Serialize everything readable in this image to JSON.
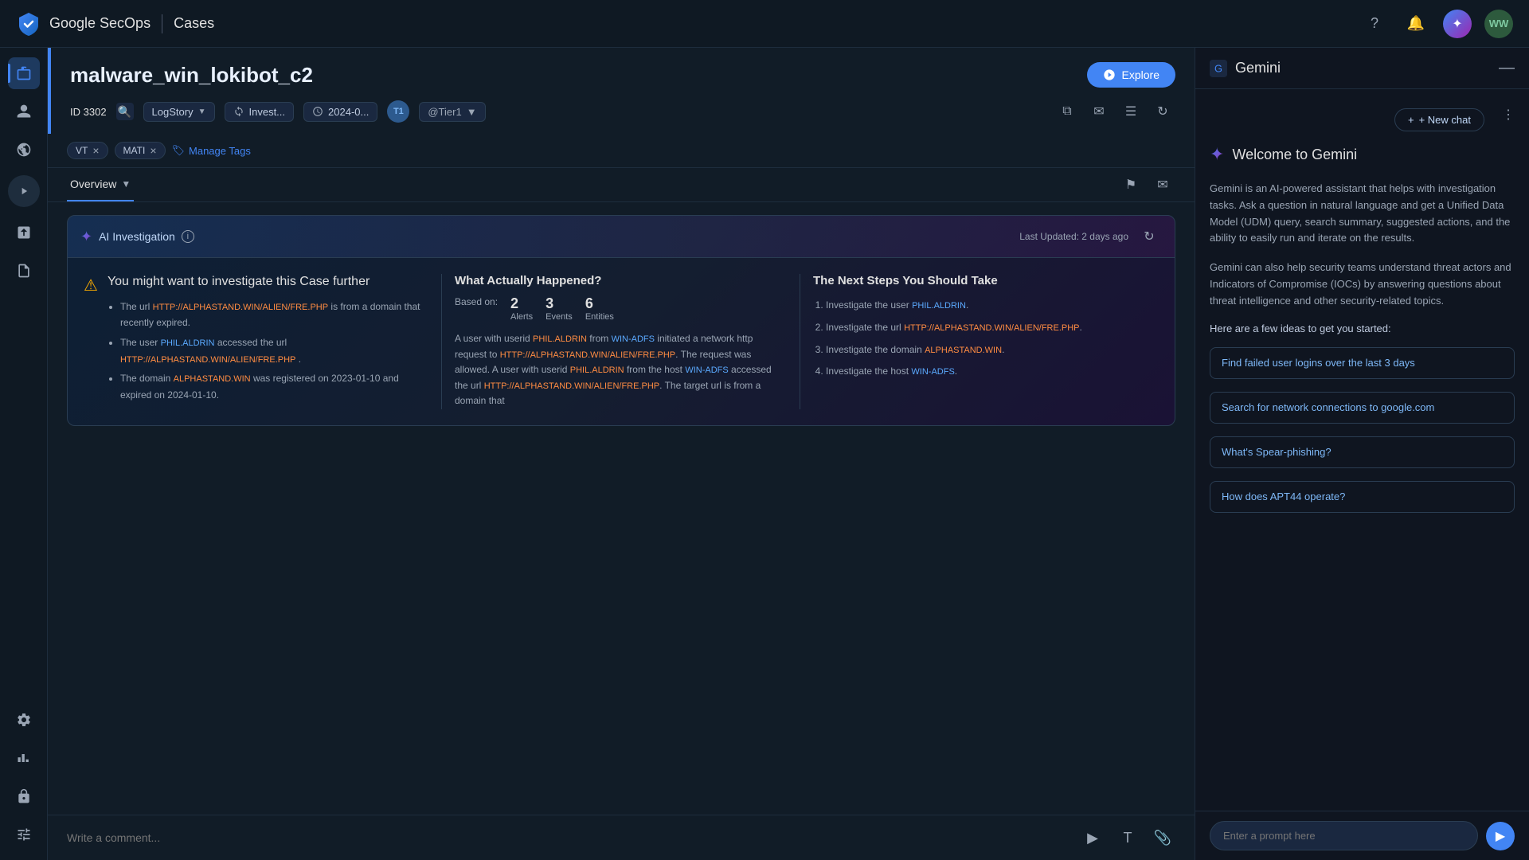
{
  "app": {
    "title": "Google SecOps",
    "section": "Cases"
  },
  "topnav": {
    "help_label": "?",
    "avatar_label": "WW"
  },
  "case": {
    "title": "malware_win_lokibot_c2",
    "id_label": "ID",
    "id_value": "3302",
    "source": "LogStory",
    "status": "Invest...",
    "date": "2024-0...",
    "tier": "T1",
    "assignee": "@Tier1",
    "explore_label": "Explore"
  },
  "tags": {
    "tag1": "VT",
    "tag2": "MATI",
    "manage_label": "Manage Tags"
  },
  "overview_tab": {
    "label": "Overview"
  },
  "ai_investigation": {
    "title": "AI Investigation",
    "last_updated": "Last Updated: 2 days ago",
    "warning_title": "You might want to investigate this Case further",
    "warning_items": [
      "The url HTTP://ALPHASTAND.WIN/ALIEN/FRE.PHP is from a domain that recently expired.",
      "The user PHIL.ALDRIN accessed the url HTTP://ALPHASTAND.WIN/ALIEN/FRE.PHP .",
      "The domain ALPHASTAND.WIN was registered on 2023-01-10 and expired on 2024-01-10."
    ],
    "what_happened_title": "What Actually Happened?",
    "based_on_label": "Based on:",
    "alerts_count": "2",
    "alerts_label": "Alerts",
    "events_count": "3",
    "events_label": "Events",
    "entities_count": "6",
    "entities_label": "Entities",
    "what_happened_text": "A user with userid PHIL.ALDRIN from WIN-ADFS initiated a network http request to HTTP://ALPHASTAND.WIN/ALIEN/FRE.PHP. The request was allowed. A user with userid PHIL.ALDRIN from the host WIN-ADFS accessed the url HTTP://ALPHASTAND.WIN/ALIEN/FRE.PHP. The target url is from a domain that",
    "next_steps_title": "The Next Steps You Should Take",
    "next_steps": [
      {
        "num": 1,
        "text": "Investigate the user PHIL.ALDRIN."
      },
      {
        "num": 2,
        "text": "Investigate the url HTTP://ALPHASTAND.WIN/ALIEN/FRE.PHP."
      },
      {
        "num": 3,
        "text": "Investigate the domain ALPHASTAND.WIN."
      },
      {
        "num": 4,
        "text": "Investigate the host WIN-ADFS."
      }
    ]
  },
  "comment": {
    "placeholder": "Write a comment..."
  },
  "gemini": {
    "title": "Gemini",
    "new_chat_label": "+ New chat",
    "welcome_title": "Welcome to Gemini",
    "description1": "Gemini is an AI-powered assistant that helps with investigation tasks. Ask a question in natural language and get a Unified Data Model (UDM) query, search summary, suggested actions, and the ability to easily run and iterate on the results.",
    "description2": "Gemini can also help security teams understand threat actors and Indicators of Compromise (IOCs) by answering questions about threat intelligence and other security-related topics.",
    "ideas_title": "Here are a few ideas to get you started:",
    "suggestions": [
      "Find failed user logins over the last 3 days",
      "Search for network connections to google.com",
      "What's Spear-phishing?",
      "How does APT44 operate?"
    ],
    "prompt_placeholder": "Enter a prompt here"
  },
  "sidebar": {
    "items": [
      {
        "icon": "📁",
        "name": "cases-icon"
      },
      {
        "icon": "👤",
        "name": "users-icon"
      },
      {
        "icon": "🌐",
        "name": "network-icon"
      },
      {
        "icon": "📊",
        "name": "analytics-icon"
      },
      {
        "icon": "📋",
        "name": "reports-icon"
      },
      {
        "icon": "⚙️",
        "name": "settings-icon"
      },
      {
        "icon": "📈",
        "name": "metrics-icon"
      },
      {
        "icon": "🔒",
        "name": "security-icon"
      },
      {
        "icon": "⚙",
        "name": "config-icon"
      }
    ]
  }
}
